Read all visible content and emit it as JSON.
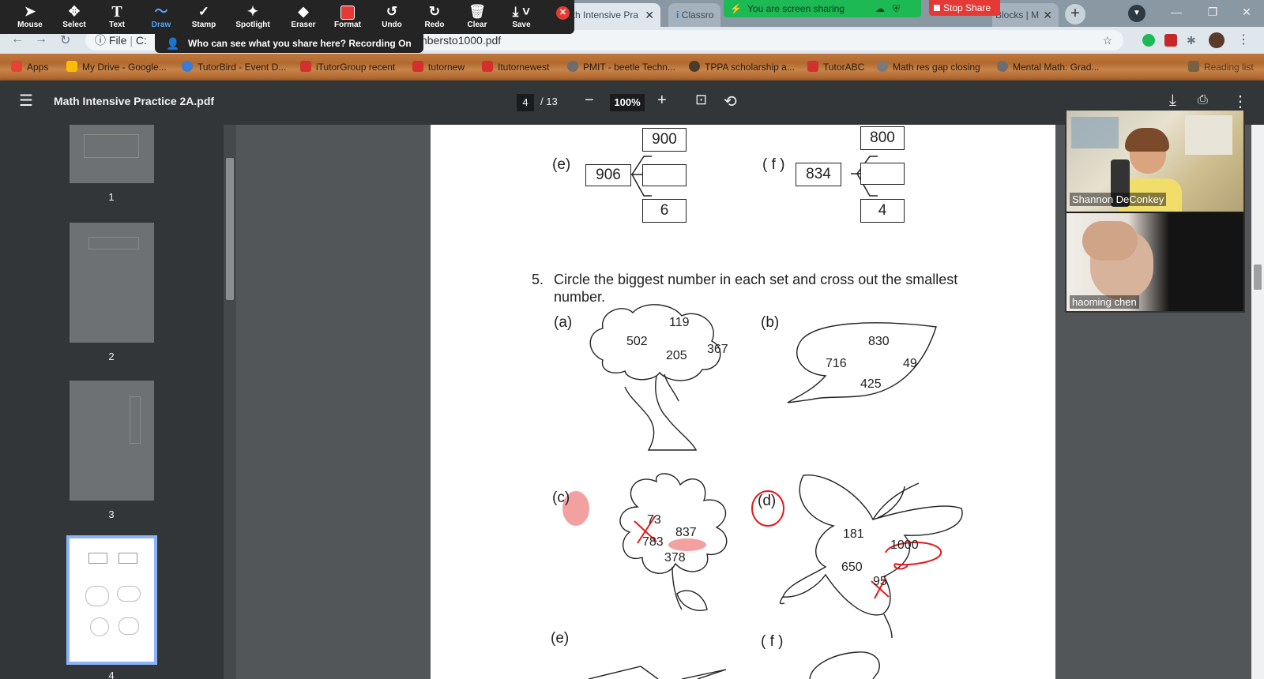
{
  "zoom_toolbar": {
    "tools": [
      {
        "name": "Mouse",
        "icon": "cursor-icon"
      },
      {
        "name": "Select",
        "icon": "move-icon"
      },
      {
        "name": "Text",
        "icon": "text-icon"
      },
      {
        "name": "Draw",
        "icon": "draw-icon"
      },
      {
        "name": "Stamp",
        "icon": "check-icon"
      },
      {
        "name": "Spotlight",
        "icon": "wand-icon"
      },
      {
        "name": "Eraser",
        "icon": "eraser-icon"
      },
      {
        "name": "Format",
        "icon": "format-icon"
      },
      {
        "name": "Undo",
        "icon": "undo-icon"
      },
      {
        "name": "Redo",
        "icon": "redo-icon"
      },
      {
        "name": "Clear",
        "icon": "trash-icon"
      },
      {
        "name": "Save",
        "icon": "save-icon"
      }
    ],
    "active_tool": "Draw",
    "share_status": "You are screen sharing",
    "stop_share": "Stop Share",
    "who_can_see": "Who can see what you share here? Recording On"
  },
  "browser": {
    "tabs": [
      {
        "title": "ath Intensive Pra"
      },
      {
        "title": "Classro"
      },
      {
        "title": "Blocks | M"
      }
    ],
    "url_prefix": "File",
    "url_drive": "C:",
    "url_tail": "nbersto1000.pdf",
    "bookmarks": [
      {
        "label": "Apps",
        "color": "#e94235"
      },
      {
        "label": "My Drive - Google...",
        "color": "#fbbc04"
      },
      {
        "label": "TutorBird - Event D...",
        "color": "#3a7bd5"
      },
      {
        "label": "iTutorGroup recent",
        "color": "#d32f2f"
      },
      {
        "label": "tutornew",
        "color": "#d32f2f"
      },
      {
        "label": "Itutornewest",
        "color": "#d32f2f"
      },
      {
        "label": "PMIT - beetle Techn...",
        "color": "#6d6d6d"
      },
      {
        "label": "TPPA scholarship a...",
        "color": "#4a3b2a"
      },
      {
        "label": "TutorABC",
        "color": "#d32f2f"
      },
      {
        "label": "Math res gap closing",
        "color": "#7a7a7a"
      },
      {
        "label": "Mental Math: Grad...",
        "color": "#6d6d6d"
      },
      {
        "label": "Reading list",
        "color": "#7a6040"
      }
    ]
  },
  "pdf": {
    "title": "Math Intensive Practice 2A.pdf",
    "page_current": "4",
    "page_total": "/ 13",
    "zoom": "100%",
    "thumbnails": [
      "1",
      "2",
      "3",
      "4"
    ],
    "content": {
      "q_e": {
        "label": "(e)",
        "top": "900",
        "center": "906",
        "middle": "",
        "bottom": "6"
      },
      "q_f": {
        "label": "( f )",
        "top": "800",
        "center": "834",
        "middle": "",
        "bottom": "4"
      },
      "q5_number": "5.",
      "q5_text_1": "Circle the biggest number in each set and cross out the smallest",
      "q5_text_2": "number.",
      "a": {
        "label": "(a)",
        "nums": [
          "119",
          "502",
          "205",
          "367"
        ]
      },
      "b": {
        "label": "(b)",
        "nums": [
          "830",
          "716",
          "49",
          "425"
        ]
      },
      "c": {
        "label": "(c)",
        "nums": [
          "73",
          "837",
          "783",
          "378"
        ]
      },
      "d": {
        "label": "(d)",
        "nums": [
          "181",
          "1000",
          "650",
          "95"
        ]
      },
      "e2": {
        "label": "(e)"
      },
      "f2": {
        "label": "( f )"
      }
    }
  },
  "video": {
    "participants": [
      {
        "name": "Shannon DeConkey"
      },
      {
        "name": "haoming   chen"
      }
    ]
  },
  "colors": {
    "accent_red": "#e53935",
    "share_green": "#1db954",
    "pdf_dark": "#323639"
  }
}
